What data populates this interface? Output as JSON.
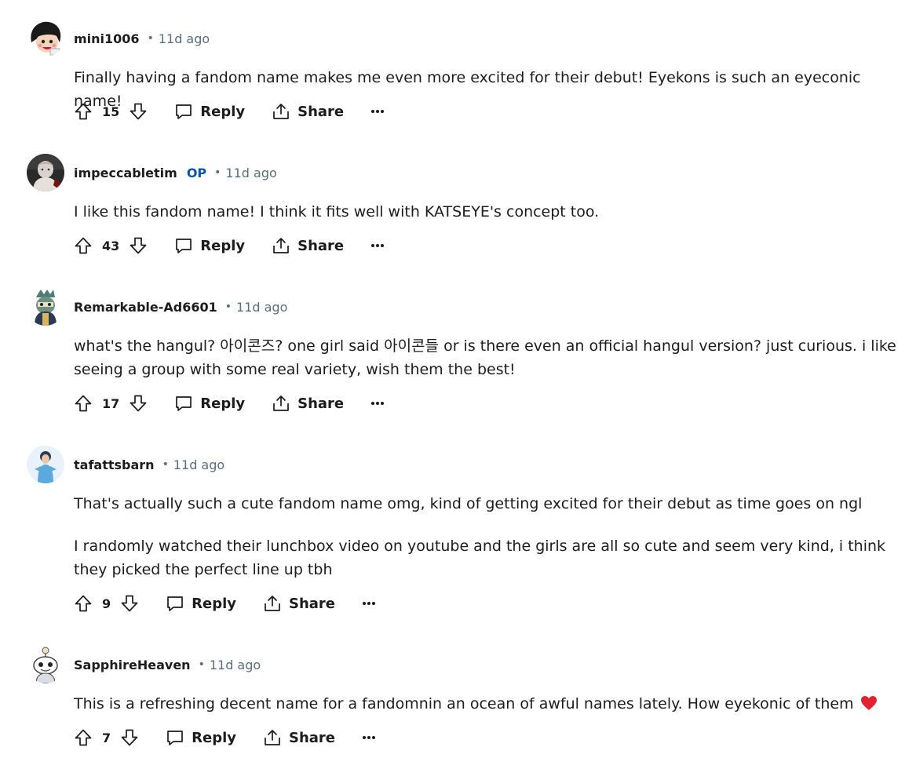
{
  "comments": [
    {
      "username": "mini1006",
      "op": "",
      "time": "11d ago",
      "paragraphs": [
        "Finally having a fandom name makes me even more excited for their debut! Eyekons is such an eyeconic name!"
      ],
      "score": "15",
      "reply_label": "Reply",
      "share_label": "Share",
      "more_label": "···"
    },
    {
      "username": "impeccabletim",
      "op": "OP",
      "time": "11d ago",
      "paragraphs": [
        "I like this fandom name! I think it fits well with KATSEYE's concept too."
      ],
      "score": "43",
      "reply_label": "Reply",
      "share_label": "Share",
      "more_label": "···"
    },
    {
      "username": "Remarkable-Ad6601",
      "op": "",
      "time": "11d ago",
      "paragraphs": [
        "what's the hangul? 아이콘즈? one girl said 아이콘들 or is there even an official hangul version? just curious. i like seeing a group with some real variety, wish them the best!"
      ],
      "score": "17",
      "reply_label": "Reply",
      "share_label": "Share",
      "more_label": "···"
    },
    {
      "username": "tafattsbarn",
      "op": "",
      "time": "11d ago",
      "paragraphs": [
        "That's actually such a cute fandom name omg, kind of getting excited for their debut as time goes on ngl",
        "I randomly watched their lunchbox video on youtube and the girls are all so cute and seem very kind, i think they picked the perfect line up tbh"
      ],
      "score": "9",
      "reply_label": "Reply",
      "share_label": "Share",
      "more_label": "···"
    },
    {
      "username": "SapphireHeaven",
      "op": "",
      "time": "11d ago",
      "paragraphs": [
        "This is a refreshing decent name for a fandomnin an ocean of awful names lately. How eyekonic of them"
      ],
      "score": "7",
      "reply_label": "Reply",
      "share_label": "Share",
      "more_label": "···",
      "emoji": "heart-icon"
    }
  ],
  "colors": {
    "text": "#1c1c1c",
    "meta": "#576f76",
    "op_badge": "#0a55a8",
    "heart": "#e0222f"
  },
  "separator": "•"
}
